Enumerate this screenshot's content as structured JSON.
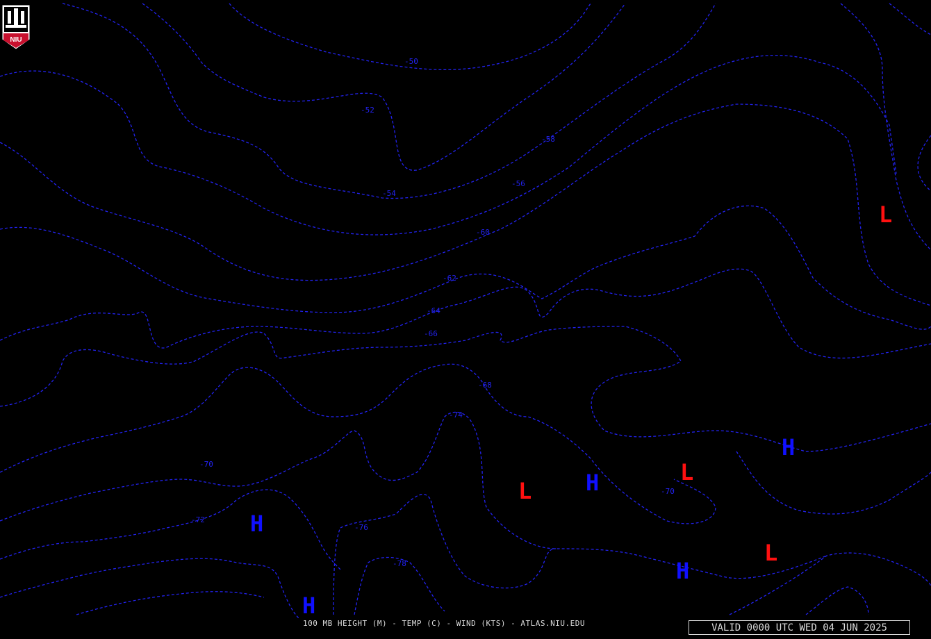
{
  "logo": {
    "text": "NIU",
    "color": "#c8102e"
  },
  "caption": "100 MB HEIGHT (M) - TEMP (C) - WIND (KTS) - ATLAS.NIU.EDU",
  "valid_time": "VALID 0000 UTC WED 04 JUN 2025",
  "colors": {
    "background": "#000000",
    "contours": "#2222ee",
    "high": "#1010ff",
    "low": "#ff1010",
    "text": "#dcdcdc"
  },
  "contour_labels": [
    "-50",
    "-52",
    "-58",
    "-56",
    "-54",
    "-60",
    "-62",
    "-64",
    "-66",
    "-68",
    "-74",
    "-70",
    "-72",
    "-76",
    "-78",
    "-70"
  ],
  "pressure_centers": [
    "L",
    "H",
    "L",
    "H",
    "L",
    "H",
    "H",
    "L",
    "H"
  ]
}
